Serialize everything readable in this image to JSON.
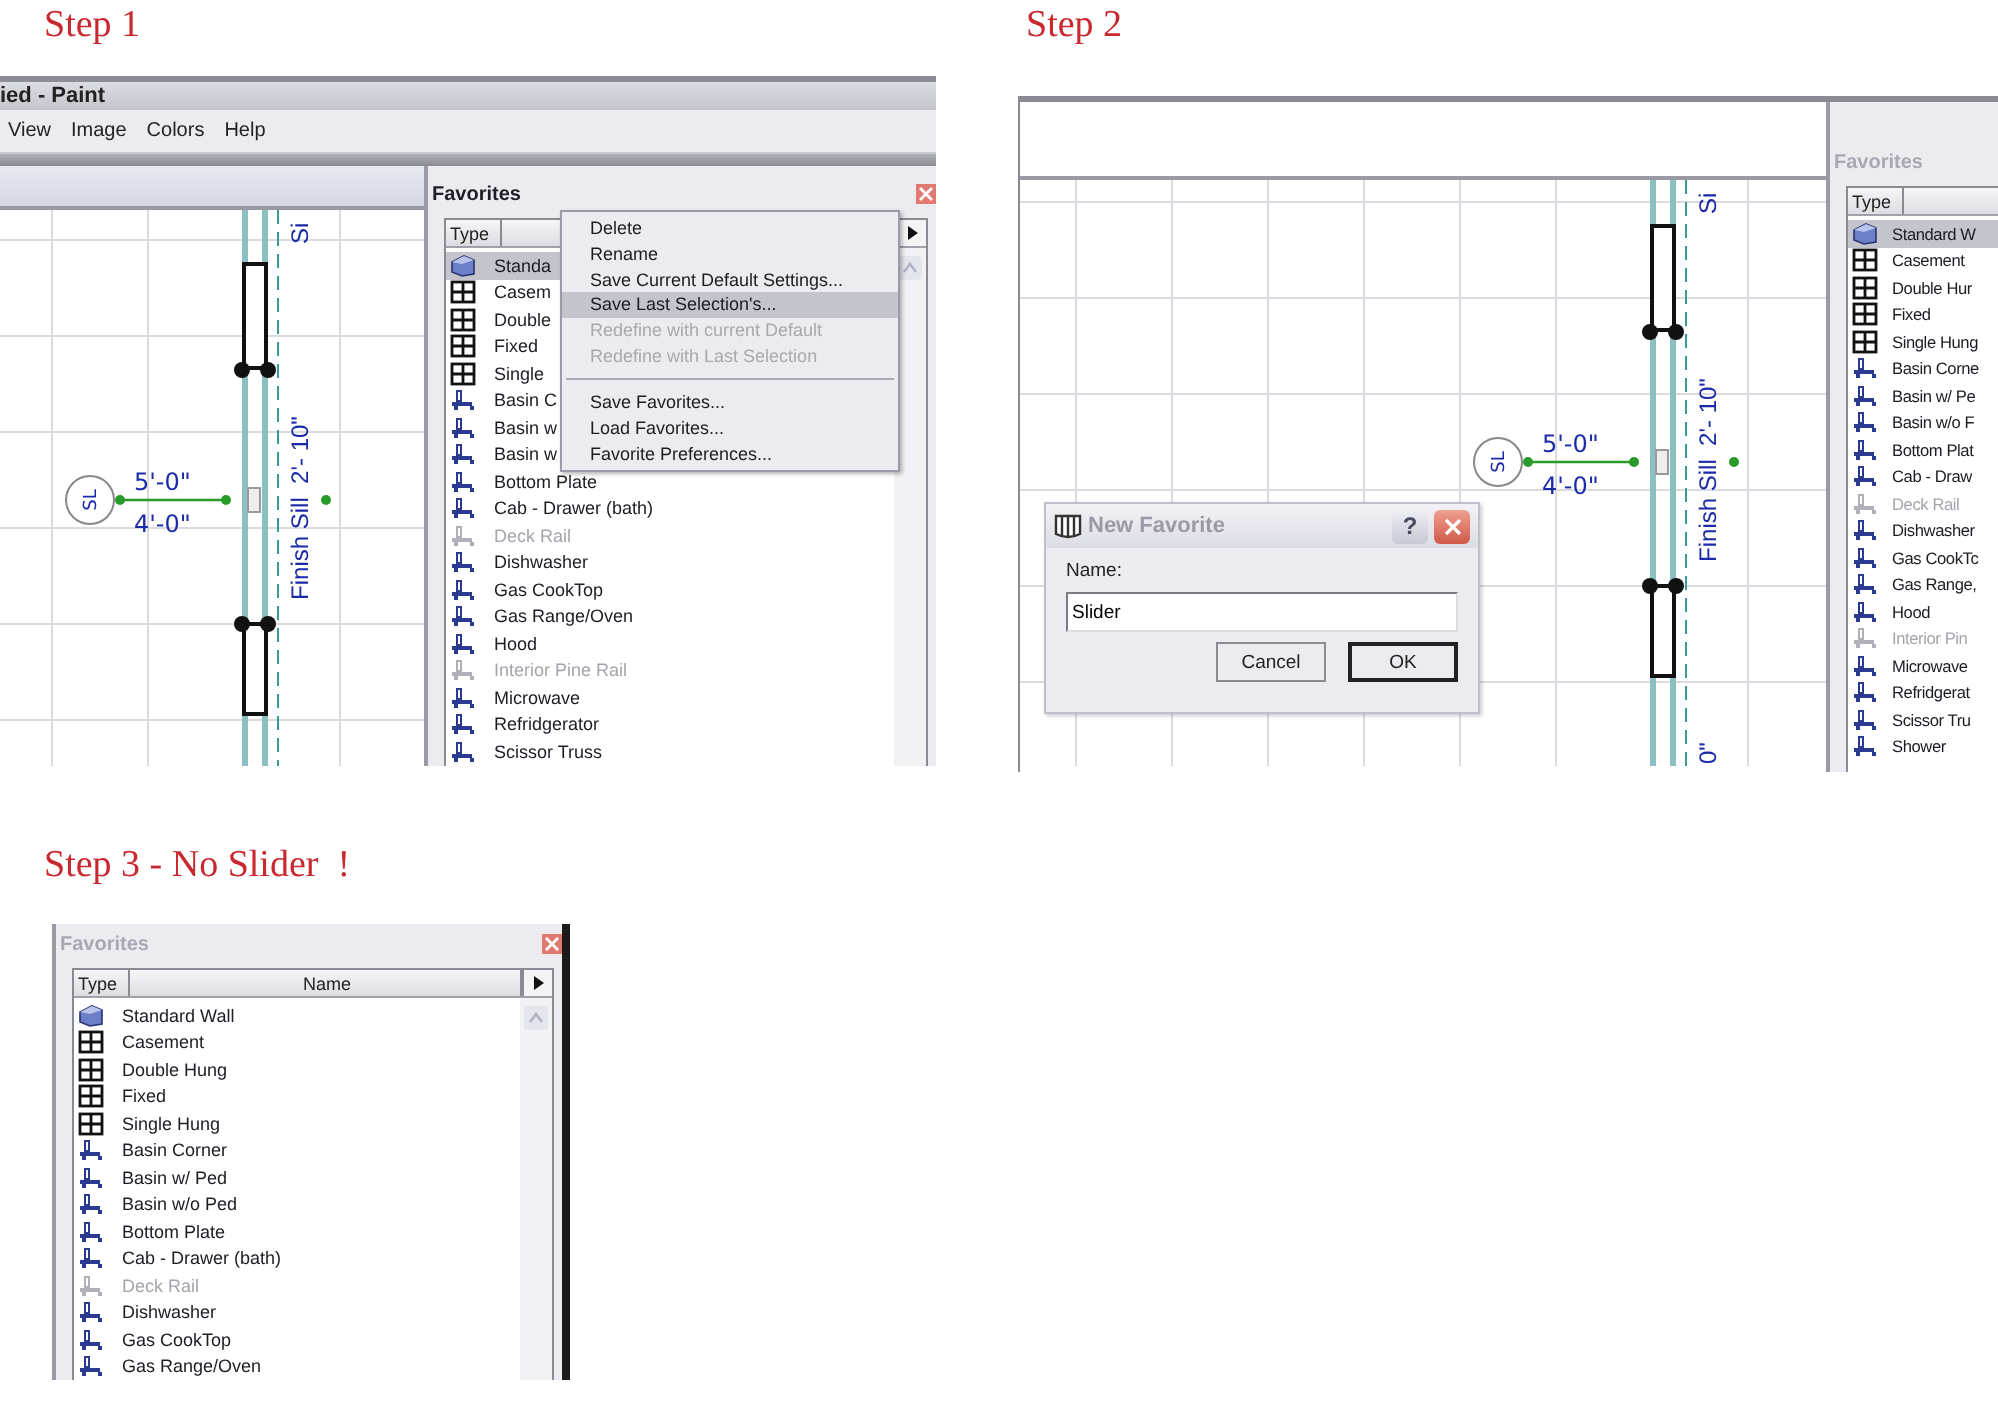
{
  "step1": {
    "heading": "Step 1",
    "window_title": "ied - Paint",
    "menu": [
      "View",
      "Image",
      "Colors",
      "Help"
    ],
    "drawing": {
      "tag": "SL",
      "dim_top": "5'-0\"",
      "dim_bottom": "4'-0\"",
      "sill": "Finish Sill  2'- 10\"",
      "top_cut": "Si"
    },
    "favorites": {
      "title": "Favorites",
      "active": true,
      "columns": [
        "Type"
      ],
      "items": [
        {
          "name": "Standa",
          "kind": "wall",
          "disabled": false,
          "selected": true
        },
        {
          "name": "Casem",
          "kind": "window",
          "disabled": false,
          "selected": false
        },
        {
          "name": "Double",
          "kind": "window",
          "disabled": false,
          "selected": false
        },
        {
          "name": "Fixed",
          "kind": "window",
          "disabled": false,
          "selected": false
        },
        {
          "name": "Single",
          "kind": "window",
          "disabled": false,
          "selected": false
        },
        {
          "name": "Basin C",
          "kind": "fixture",
          "disabled": false,
          "selected": false
        },
        {
          "name": "Basin w",
          "kind": "fixture",
          "disabled": false,
          "selected": false
        },
        {
          "name": "Basin w",
          "kind": "fixture",
          "disabled": false,
          "selected": false
        },
        {
          "name": "Bottom Plate",
          "kind": "fixture",
          "disabled": false,
          "selected": false
        },
        {
          "name": "Cab - Drawer (bath)",
          "kind": "fixture",
          "disabled": false,
          "selected": false
        },
        {
          "name": "Deck Rail",
          "kind": "fixture",
          "disabled": true,
          "selected": false
        },
        {
          "name": "Dishwasher",
          "kind": "fixture",
          "disabled": false,
          "selected": false
        },
        {
          "name": "Gas CookTop",
          "kind": "fixture",
          "disabled": false,
          "selected": false
        },
        {
          "name": "Gas Range/Oven",
          "kind": "fixture",
          "disabled": false,
          "selected": false
        },
        {
          "name": "Hood",
          "kind": "fixture",
          "disabled": false,
          "selected": false
        },
        {
          "name": "Interior Pine Rail",
          "kind": "fixture",
          "disabled": true,
          "selected": false
        },
        {
          "name": "Microwave",
          "kind": "fixture",
          "disabled": false,
          "selected": false
        },
        {
          "name": "Refridgerator",
          "kind": "fixture",
          "disabled": false,
          "selected": false
        },
        {
          "name": "Scissor Truss",
          "kind": "fixture",
          "disabled": false,
          "selected": false
        }
      ]
    },
    "context_menu": [
      [
        {
          "label": "Delete",
          "disabled": false,
          "highlighted": false
        },
        {
          "label": "Rename",
          "disabled": false,
          "highlighted": false
        },
        {
          "label": "Save Current Default Settings...",
          "disabled": false,
          "highlighted": false
        },
        {
          "label": "Save Last Selection's...",
          "disabled": false,
          "highlighted": true
        },
        {
          "label": "Redefine with current Default",
          "disabled": true,
          "highlighted": false
        },
        {
          "label": "Redefine with Last Selection",
          "disabled": true,
          "highlighted": false
        }
      ],
      [
        {
          "label": "Save Favorites...",
          "disabled": false,
          "highlighted": false
        },
        {
          "label": "Load Favorites...",
          "disabled": false,
          "highlighted": false
        },
        {
          "label": "Favorite Preferences...",
          "disabled": false,
          "highlighted": false
        }
      ]
    ]
  },
  "step2": {
    "heading": "Step 2",
    "drawing": {
      "tag": "SL",
      "dim_top": "5'-0\"",
      "dim_bottom": "4'-0\"",
      "sill": "Finish Sill  2'- 10\"",
      "top_cut": "Si",
      "bottom_cut": "0\""
    },
    "favorites": {
      "title": "Favorites",
      "active": false,
      "columns": [
        "Type"
      ],
      "items": [
        {
          "name": "Standard W",
          "kind": "wall",
          "disabled": false,
          "selected": true
        },
        {
          "name": "Casement",
          "kind": "window",
          "disabled": false,
          "selected": false
        },
        {
          "name": "Double Hur",
          "kind": "window",
          "disabled": false,
          "selected": false
        },
        {
          "name": "Fixed",
          "kind": "window",
          "disabled": false,
          "selected": false
        },
        {
          "name": "Single Hung",
          "kind": "window",
          "disabled": false,
          "selected": false
        },
        {
          "name": "Basin Corne",
          "kind": "fixture",
          "disabled": false,
          "selected": false
        },
        {
          "name": "Basin w/ Pe",
          "kind": "fixture",
          "disabled": false,
          "selected": false
        },
        {
          "name": "Basin w/o F",
          "kind": "fixture",
          "disabled": false,
          "selected": false
        },
        {
          "name": "Bottom Plat",
          "kind": "fixture",
          "disabled": false,
          "selected": false
        },
        {
          "name": "Cab - Draw",
          "kind": "fixture",
          "disabled": false,
          "selected": false
        },
        {
          "name": "Deck Rail",
          "kind": "fixture",
          "disabled": true,
          "selected": false
        },
        {
          "name": "Dishwasher",
          "kind": "fixture",
          "disabled": false,
          "selected": false
        },
        {
          "name": "Gas CookTc",
          "kind": "fixture",
          "disabled": false,
          "selected": false
        },
        {
          "name": "Gas Range,",
          "kind": "fixture",
          "disabled": false,
          "selected": false
        },
        {
          "name": "Hood",
          "kind": "fixture",
          "disabled": false,
          "selected": false
        },
        {
          "name": "Interior Pin",
          "kind": "fixture",
          "disabled": true,
          "selected": false
        },
        {
          "name": "Microwave",
          "kind": "fixture",
          "disabled": false,
          "selected": false
        },
        {
          "name": "Refridgerat",
          "kind": "fixture",
          "disabled": false,
          "selected": false
        },
        {
          "name": "Scissor Tru",
          "kind": "fixture",
          "disabled": false,
          "selected": false
        },
        {
          "name": "Shower",
          "kind": "fixture",
          "disabled": false,
          "selected": false
        }
      ]
    },
    "dialog": {
      "title": "New Favorite",
      "help": "?",
      "field_label": "Name:",
      "value": "Slider",
      "buttons": [
        {
          "label": "Cancel",
          "default": false
        },
        {
          "label": "OK",
          "default": true
        }
      ]
    }
  },
  "step3": {
    "heading": "Step 3 - No Slider  !",
    "favorites": {
      "title": "Favorites",
      "active": false,
      "columns": [
        "Type",
        "Name"
      ],
      "items": [
        {
          "name": "Standard Wall",
          "kind": "wall",
          "disabled": false,
          "selected": false
        },
        {
          "name": "Casement",
          "kind": "window",
          "disabled": false,
          "selected": false
        },
        {
          "name": "Double Hung",
          "kind": "window",
          "disabled": false,
          "selected": false
        },
        {
          "name": "Fixed",
          "kind": "window",
          "disabled": false,
          "selected": false
        },
        {
          "name": "Single Hung",
          "kind": "window",
          "disabled": false,
          "selected": false
        },
        {
          "name": "Basin Corner",
          "kind": "fixture",
          "disabled": false,
          "selected": false
        },
        {
          "name": "Basin w/ Ped",
          "kind": "fixture",
          "disabled": false,
          "selected": false
        },
        {
          "name": "Basin w/o Ped",
          "kind": "fixture",
          "disabled": false,
          "selected": false
        },
        {
          "name": "Bottom Plate",
          "kind": "fixture",
          "disabled": false,
          "selected": false
        },
        {
          "name": "Cab - Drawer (bath)",
          "kind": "fixture",
          "disabled": false,
          "selected": false
        },
        {
          "name": "Deck Rail",
          "kind": "fixture",
          "disabled": true,
          "selected": false
        },
        {
          "name": "Dishwasher",
          "kind": "fixture",
          "disabled": false,
          "selected": false
        },
        {
          "name": "Gas CookTop",
          "kind": "fixture",
          "disabled": false,
          "selected": false
        },
        {
          "name": "Gas Range/Oven",
          "kind": "fixture",
          "disabled": false,
          "selected": false
        }
      ]
    }
  }
}
